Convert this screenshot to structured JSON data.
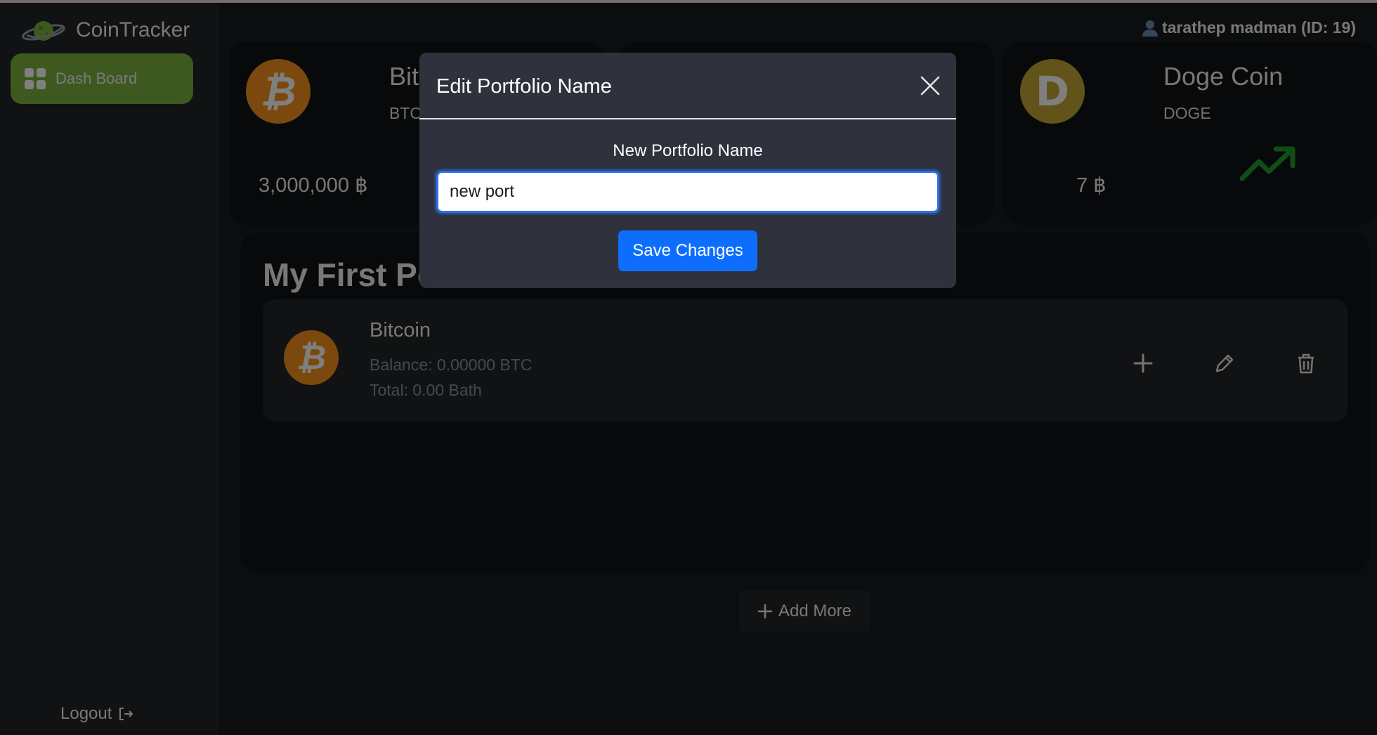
{
  "app": {
    "title": "CoinTracker"
  },
  "sidebar": {
    "items": [
      {
        "label": "Dash Board",
        "active": true,
        "icon": "grid-icon"
      }
    ],
    "logout_label": "Logout"
  },
  "header": {
    "user": "tarathep madman (ID: 19)"
  },
  "coins": [
    {
      "name": "Bitcoin",
      "symbol": "BTC",
      "price": "3,000,000 ฿",
      "icon": "bitcoin-icon",
      "color": "#f7931a"
    },
    {
      "name": "Doge Coin",
      "symbol": "DOGE",
      "price": "7 ฿",
      "icon": "dogecoin-icon",
      "color": "#c2a633",
      "trend": "up"
    }
  ],
  "portfolio": {
    "title": "My First Portfolio",
    "holdings": [
      {
        "name": "Bitcoin",
        "balance": "Balance: 0.00000 BTC",
        "total": "Total: 0.00 Bath",
        "icon": "bitcoin-icon"
      }
    ],
    "add_more_label": "Add More"
  },
  "modal": {
    "title": "Edit Portfolio Name",
    "field_label": "New Portfolio Name",
    "input_value": "new port",
    "save_label": "Save Changes"
  },
  "colors": {
    "accent": "#7bb241",
    "primary": "#0d6efd",
    "trend_up": "#1f9d2a"
  }
}
